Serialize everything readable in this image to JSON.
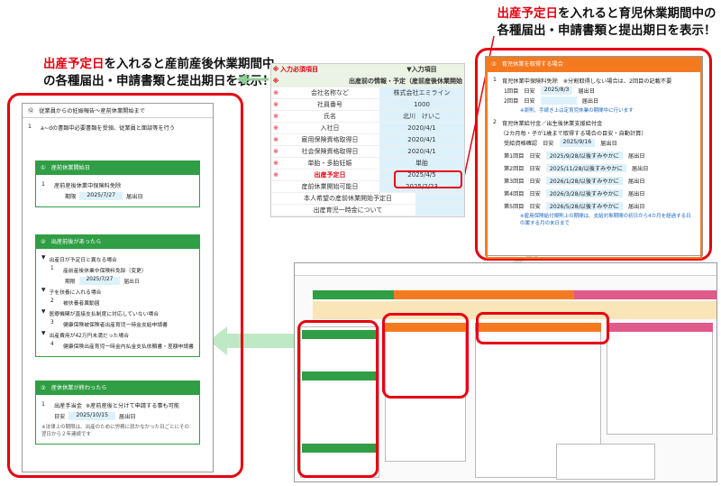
{
  "headline_left": {
    "red": "出産予定日",
    "rest1": "を入れると産前産後休業期間中",
    "line2": "の各種届出・申請書類と提出期日を表示！"
  },
  "headline_right": {
    "red": "出産予定日",
    "rest1": "を入れると育児休業期間中の",
    "line2": "各種届出・申請書類と提出期日を表示！"
  },
  "input_table": {
    "required_label": "入力必須項目",
    "input_item": "▼入力項目",
    "section": "出産前の情報・予定（産前産後休業開始",
    "rows": [
      {
        "label": "会社名称など",
        "value": "株式会社エミライン"
      },
      {
        "label": "社員番号",
        "value": "1000"
      },
      {
        "label": "氏名",
        "value": "北川　けいこ"
      },
      {
        "label": "入社日",
        "value": "2020/4/1"
      },
      {
        "label": "雇用保険資格取得日",
        "value": "2020/4/1"
      },
      {
        "label": "社会保険資格取得日",
        "value": "2020/4/1"
      },
      {
        "label": "単胎・多胎妊娠",
        "value": "単胎"
      },
      {
        "label": "出産予定日",
        "value": "2025/4/5"
      },
      {
        "label": "産前休業開始可能日",
        "value": "2025/2/23"
      },
      {
        "label": "本人希望の産前休業開始予定日",
        "value": ""
      },
      {
        "label": "出産育児一時金について",
        "value": ""
      }
    ]
  },
  "left_panel": {
    "title": "従業員からの妊娠報告～産前休業開始まで",
    "item1": "a~dの書類中必要書類を受領、従業員と面談等を行う",
    "sec1_head": "産前休業開始日",
    "sec1_item": "産前産後休業中保険料免除",
    "period_label": "期限",
    "date1": "2025/7/27",
    "submit": "届出日",
    "sec2_head": "出産前後があったら",
    "sec2_lines": [
      "出産日が予定日と異なる場合",
      "産前産後休業中保険料免除（変更）",
      "子を扶養に入れる場合",
      "被扶養者異動届",
      "医療機関が直接支払制度に対応していない場合",
      "健康保険被保険者出産育児一時金支給申請書",
      "出産費用が42万円未満だった場合",
      "健康保険出産育児一時金内払金支払依頼書・差額申請書"
    ],
    "date2": "2025/7/27",
    "sec3_head": "産休休業が終わったら",
    "sec3_item": "出産手当金",
    "sec3_note": "※産前産後と分けて申請する事も可能",
    "date3_label": "日安",
    "date3": "2025/10/15",
    "footnote": "※法律上の期限は、出産のために労務に就かなかった日ごとにその翌日から２年連続です"
  },
  "right_panel": {
    "head": "育児休業を取得する場合",
    "item1": "育児休業中保険料免除",
    "item1_note": "※分割取得しない場合は、2回目の記載不要",
    "r1_label": "1回目",
    "r1_date": "2025/8/3",
    "r2_label": "2回目",
    "est_label": "日安",
    "submit": "届出日",
    "note1": "※原則、手続き上は定育児休業の期間中に行います",
    "item2": "育児休業給付金／出生後休業支援給付金",
    "item2_sub": "（2カ月毎・子が1歳まで取得する場合の目安・自動計算）",
    "recv_label": "受給資格確認",
    "recv_date": "2025/9/16",
    "rounds": [
      {
        "label": "第1回目",
        "date": "2025/9/28/以後すみやかに"
      },
      {
        "label": "第2回目",
        "date": "2025/11/28/以後すみやかに"
      },
      {
        "label": "第3回目",
        "date": "2026/1/28/以後すみやかに"
      },
      {
        "label": "第4回目",
        "date": "2026/3/28/以後すみやかに"
      },
      {
        "label": "第5回目",
        "date": "2026/5/28/以後すみやかに"
      }
    ],
    "note2": "※雇用保険給付規則上の期間は、支給対象期間の初日から4カ月を経過する日の属する月の末日まで"
  },
  "colors": {
    "red": "#e60012",
    "green": "#2f9e44",
    "orange": "#f47a20",
    "blue_cell": "#ddf1fb",
    "arrow": "#bfe8c4"
  }
}
